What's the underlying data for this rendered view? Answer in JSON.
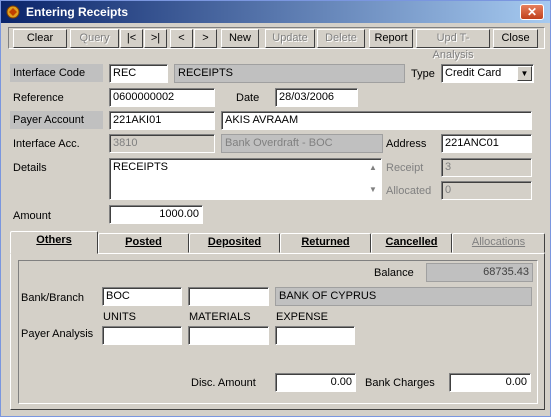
{
  "window": {
    "title": "Entering Receipts",
    "close_glyph": "✕"
  },
  "toolbar": {
    "clear": "Clear",
    "query": "Query",
    "first": "|<",
    "last": ">|",
    "prev": "<",
    "next": ">",
    "new": "New",
    "update": "Update",
    "delete": "Delete",
    "report": "Report",
    "upd_t_analysis": "Upd T-Analysis",
    "close": "Close"
  },
  "form": {
    "interface_code_label": "Interface Code",
    "interface_code": "REC",
    "interface_name": "RECEIPTS",
    "type_label": "Type",
    "type_value": "Credit Card",
    "reference_label": "Reference",
    "reference": "0600000002",
    "date_label": "Date",
    "date": "28/03/2006",
    "payer_account_label": "Payer Account",
    "payer_account": "221AKI01",
    "payer_name": "AKIS AVRAAM",
    "interface_acc_label": "Interface Acc.",
    "interface_acc": "3810",
    "interface_acc_name": "Bank Overdraft - BOC",
    "address_label": "Address",
    "address": "221ANC01",
    "details_label": "Details",
    "details": "RECEIPTS",
    "receipt_label": "Receipt",
    "receipt": "3",
    "allocated_label": "Allocated",
    "allocated": "0",
    "amount_label": "Amount",
    "amount": "1000.00"
  },
  "tabs": {
    "others": "Others",
    "posted": "Posted",
    "deposited": "Deposited",
    "returned": "Returned",
    "cancelled": "Cancelled",
    "allocations": "Allocations"
  },
  "others": {
    "balance_label": "Balance",
    "balance": "68735.43",
    "bank_branch_label": "Bank/Branch",
    "bank_code": "BOC",
    "branch_code": "",
    "bank_name": "BANK OF CYPRUS",
    "units_label": "UNITS",
    "materials_label": "MATERIALS",
    "expense_label": "EXPENSE",
    "payer_analysis_label": "Payer Analysis",
    "units": "",
    "materials": "",
    "expense": "",
    "disc_amount_label": "Disc. Amount",
    "disc_amount": "0.00",
    "bank_charges_label": "Bank Charges",
    "bank_charges": "0.00"
  }
}
